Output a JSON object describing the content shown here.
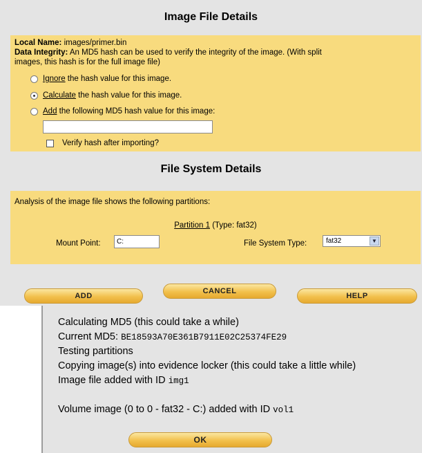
{
  "image_section": {
    "title": "Image File Details",
    "local_name_label": "Local Name:",
    "local_name_value": "images/primer.bin",
    "integrity_label": "Data Integrity:",
    "integrity_text_1": "An MD5 hash can be used to verify the integrity of the image. (With split",
    "integrity_text_2": "images, this hash is for the full image file)",
    "options": [
      {
        "link": "Ignore",
        "rest": " the hash value for this image.",
        "selected": false
      },
      {
        "link": "Calculate",
        "rest": " the hash value for this image.",
        "selected": true
      },
      {
        "link": "Add",
        "rest": " the following MD5 hash value for this image:",
        "selected": false
      }
    ],
    "md5_input_value": "",
    "verify_label": "Verify hash after importing?",
    "verify_checked": false
  },
  "fs_section": {
    "title": "File System Details",
    "analysis_text": "Analysis of the image file shows the following partitions:",
    "partition_link": "Partition 1",
    "partition_type": " (Type: fat32)",
    "mount_label": "Mount Point:",
    "mount_value": "C:",
    "fs_type_label": "File System Type:",
    "fs_type_value": "fat32"
  },
  "buttons": {
    "add": "ADD",
    "cancel": "CANCEL",
    "help": "HELP",
    "ok": "OK"
  },
  "log": {
    "line1": "Calculating MD5 (this could take a while)",
    "line2_prefix": "Current MD5: ",
    "line2_hash": "BE18593A70E361B7911E02C25374FE29",
    "line3": "Testing partitions",
    "line4": "Copying image(s) into evidence locker (this could take a little while)",
    "line5_prefix": "Image file added with ID ",
    "line5_id": "img1",
    "line6_prefix": "Volume image (0 to 0 - fat32 - C:) added with ID ",
    "line6_id": "vol1"
  },
  "colors": {
    "panel_bg": "#e4e4e4",
    "section_bg": "#f8db7e",
    "button_gold": "#f2c04c"
  },
  "icons": {
    "select_arrow": "chevron-down-icon"
  }
}
